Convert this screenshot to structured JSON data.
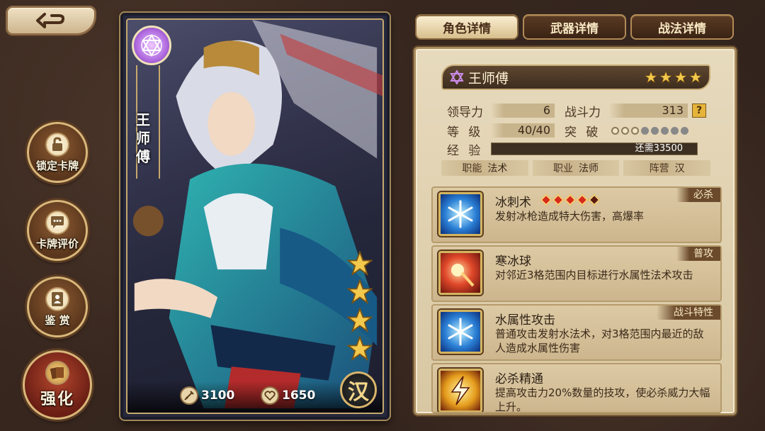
{
  "card": {
    "name_chars": [
      "王",
      "师",
      "傅"
    ],
    "attack": "3100",
    "hp": "1650",
    "faction": "汉",
    "stars": 4
  },
  "side_buttons": {
    "lock": "锁定卡牌",
    "review": "卡牌评价",
    "appreciate": "鉴 赏",
    "enhance": "强化"
  },
  "tabs": [
    "角色详情",
    "武器详情",
    "战法详情"
  ],
  "hero": {
    "name": "王师傅",
    "stars": 4,
    "leadership_label": "领导力",
    "leadership": "6",
    "combat_label": "战斗力",
    "combat": "313",
    "level_label": "等 级",
    "level": "40/40",
    "breakthrough_label": "突 破",
    "breakthrough_filled": 3,
    "breakthrough_total": 8,
    "exp_label": "经 验",
    "exp_text": "还需33500",
    "tags": [
      {
        "label": "职能",
        "value": "法术"
      },
      {
        "label": "职业",
        "value": "法师"
      },
      {
        "label": "阵营",
        "value": "汉"
      }
    ]
  },
  "skills": [
    {
      "name": "冰刺术",
      "type": "必杀",
      "desc": "发射冰枪造成特大伤害，高爆率",
      "icon": "ice-icon",
      "gems": 5
    },
    {
      "name": "寒冰球",
      "type": "普攻",
      "desc": "对邻近3格范围内目标进行水属性法术攻击",
      "icon": "fire-icon"
    },
    {
      "name": "水属性攻击",
      "type": "战斗特性",
      "desc": "普通攻击发射水法术，对3格范围内最近的敌人造成水属性伤害",
      "icon": "ice-icon"
    },
    {
      "name": "必杀精通",
      "type": "",
      "desc": "提高攻击力20%数量的技攻，使必杀威力大幅上升。",
      "icon": "bolt-icon"
    }
  ],
  "colors": {
    "gold": "#d9b77a",
    "panel": "#e7dabd",
    "brown": "#3e2d1e"
  }
}
